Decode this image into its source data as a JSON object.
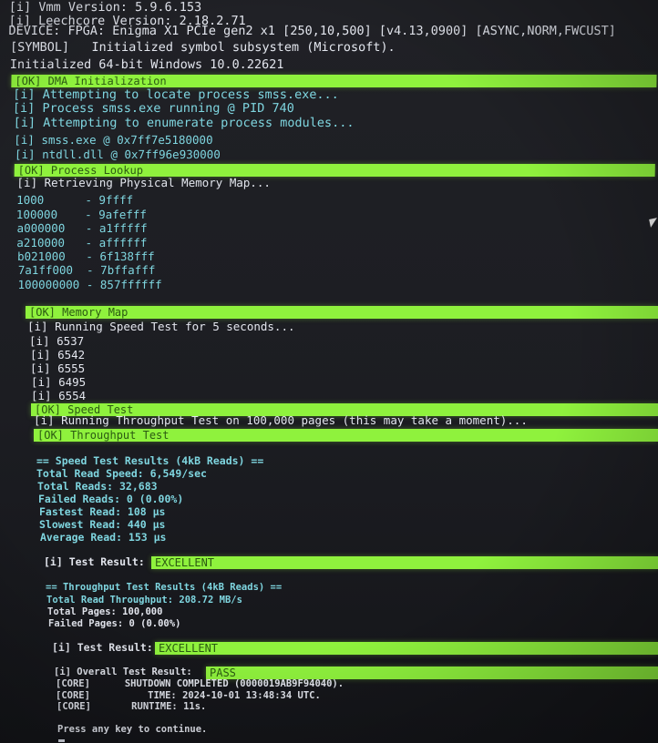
{
  "log": {
    "vmm_version": "[i] Vmm Version: 5.9.6.153",
    "leechcore_version": "[i] Leechcore Version: 2.18.2.71",
    "device": "DEVICE: FPGA: Enigma X1 PCIe gen2 x1 [250,10,500] [v4.13,0900] [ASYNC,NORM,FWCUST]",
    "symbol": "[SYMBOL]   Initialized symbol subsystem (Microsoft).",
    "windows": "Initialized 64-bit Windows 10.0.22621",
    "ok_dma": "[OK] DMA Initialization",
    "locate_process": "[i] Attempting to locate process smss.exe...",
    "process_running": "[i] Process smss.exe running @ PID 740",
    "enumerate_modules": "[i] Attempting to enumerate process modules...",
    "module_smss": "[i] smss.exe @ 0x7ff7e5180000",
    "module_ntdll": "[i] ntdll.dll @ 0x7ff96e930000",
    "ok_process_lookup": "[OK] Process Lookup",
    "retrieving_map": "[i] Retrieving Physical Memory Map...",
    "memory_map": [
      "1000      - 9ffff",
      "100000    - 9afefff",
      "a000000   - a1fffff",
      "a210000   - affffff",
      "b021000   - 6f138fff",
      "7a1ff000  - 7bffafff",
      "100000000 - 857ffffff"
    ],
    "ok_memory_map": "[OK] Memory Map",
    "speed_test_running": "[i] Running Speed Test for 5 seconds...",
    "speed_samples": [
      "[i] 6537",
      "[i] 6542",
      "[i] 6555",
      "[i] 6495",
      "[i] 6554"
    ],
    "ok_speed_test": "[OK] Speed Test",
    "throughput_running": "[i] Running Throughput Test on 100,000 pages (this may take a moment)...",
    "ok_throughput_test": "[OK] Throughput Test",
    "speed_results": {
      "header": "== Speed Test Results (4kB Reads) ==",
      "total_read_speed": "Total Read Speed: 6,549/sec",
      "total_reads": "Total Reads: 32,683",
      "failed_reads": "Failed Reads: 0 (0.00%)",
      "fastest_read": "Fastest Read: 108 µs",
      "slowest_read": "Slowest Read: 440 µs",
      "average_read": "Average Read: 153 µs",
      "result_label": "[i] Test Result:",
      "result_value": "EXCELLENT"
    },
    "throughput_results": {
      "header": "== Throughput Test Results (4kB Reads) ==",
      "total_read_throughput": "Total Read Throughput: 208.72 MB/s",
      "total_pages": "Total Pages: 100,000",
      "failed_pages": "Failed Pages: 0 (0.00%)",
      "result_label": "[i] Test Result:",
      "result_value": "EXCELLENT"
    },
    "overall": {
      "label": "[i] Overall Test Result:",
      "value": "PASS"
    },
    "core_lines": [
      "[CORE]      SHUTDOWN COMPLETED (0000019AB9F94040).",
      "[CORE]          TIME: 2024-10-01 13:48:34 UTC.",
      "[CORE]       RUNTIME: 11s."
    ],
    "press_any_key": "Press any key to continue."
  },
  "colors": {
    "background": "#1b1c20",
    "text": "#e3e6ee",
    "info_cyan": "#7fd6e0",
    "ok_bar": "#8ff23d",
    "ok_bar_text": "#2b5a12"
  }
}
